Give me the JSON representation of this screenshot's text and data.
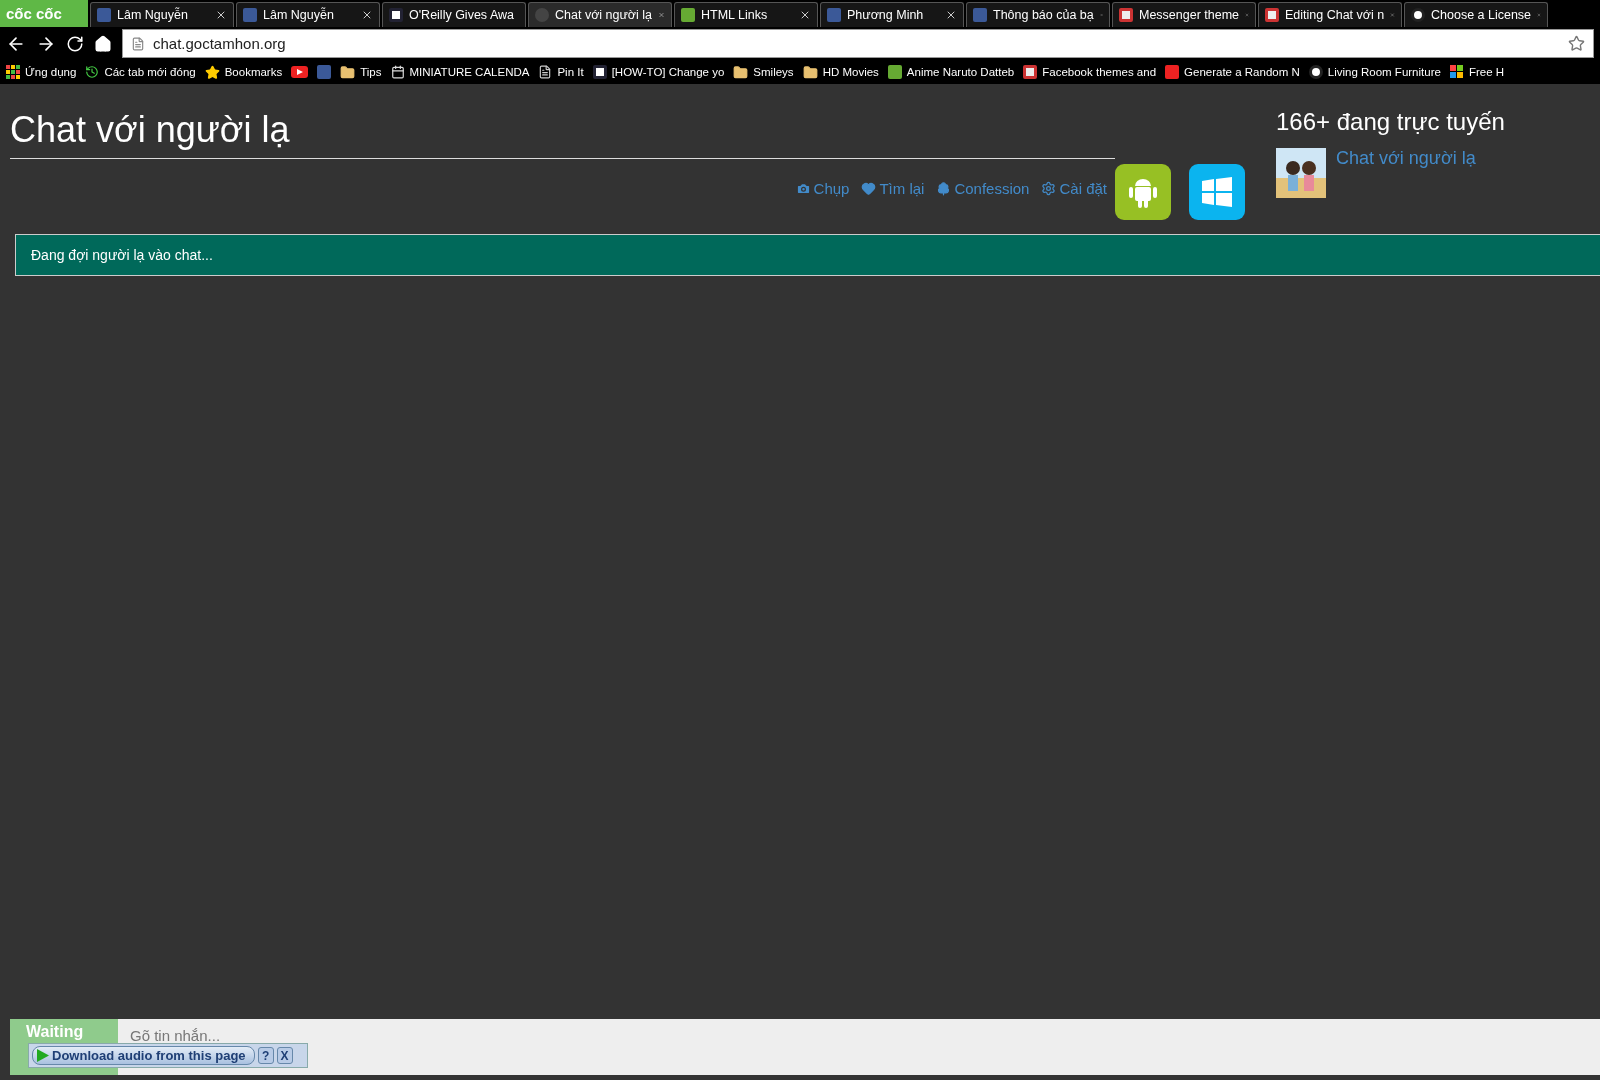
{
  "browser": {
    "logo": "cốc cốc",
    "tabs": [
      {
        "title": "Lâm Nguyễn",
        "kind": "facebook",
        "selected": false
      },
      {
        "title": "Lâm Nguyễn",
        "kind": "facebook",
        "selected": false
      },
      {
        "title": "O'Reilly Gives Awa",
        "kind": "dark",
        "selected": false
      },
      {
        "title": "Chat với người lạ",
        "kind": "bubble",
        "selected": true
      },
      {
        "title": "HTML Links",
        "kind": "green",
        "selected": false
      },
      {
        "title": "Phương Minh",
        "kind": "facebook",
        "selected": false
      },
      {
        "title": "Thông báo của bạ",
        "kind": "facebook",
        "selected": false
      },
      {
        "title": "Messenger theme",
        "kind": "light",
        "selected": false
      },
      {
        "title": "Editing Chat với n",
        "kind": "light",
        "selected": false
      },
      {
        "title": "Choose a License",
        "kind": "circle",
        "selected": false
      }
    ],
    "address": "chat.goctamhon.org",
    "bookmarks": [
      {
        "label": "Ứng dụng",
        "kind": "apps"
      },
      {
        "label": "Các tab mới đóng",
        "kind": "history"
      },
      {
        "label": "Bookmarks",
        "kind": "star"
      },
      {
        "kind": "youtube"
      },
      {
        "kind": "facebook"
      },
      {
        "label": "Tips",
        "kind": "folder"
      },
      {
        "label": "MINIATURE CALENDA",
        "kind": "calendar"
      },
      {
        "label": "Pin It",
        "kind": "page"
      },
      {
        "label": "[HOW-TO] Change yo",
        "kind": "dark"
      },
      {
        "label": "Smileys",
        "kind": "folder"
      },
      {
        "label": "HD Movies",
        "kind": "folder"
      },
      {
        "label": "Anime Naruto Datteb",
        "kind": "green"
      },
      {
        "label": "Facebook themes and",
        "kind": "light"
      },
      {
        "label": "Generate a Random N",
        "kind": "red"
      },
      {
        "label": "Living Room Furniture",
        "kind": "circle"
      },
      {
        "label": "Free H",
        "kind": "windows"
      }
    ]
  },
  "page": {
    "title": "Chat với người lạ",
    "links": [
      {
        "label": "Chụp",
        "kind": "camera"
      },
      {
        "label": "Tìm lại",
        "kind": "heart"
      },
      {
        "label": "Confession",
        "kind": "tree"
      },
      {
        "label": "Cài đặt",
        "kind": "gear"
      }
    ],
    "apps": [
      {
        "kind": "android",
        "color": "#97c024"
      },
      {
        "kind": "windows",
        "color": "#0bb4ef"
      }
    ],
    "online": "166+ đang trực tuyến",
    "feature": {
      "label": "Chat với người lạ"
    },
    "status": "Đang đợi người lạ vào chat...",
    "composer": {
      "status": "Waiting",
      "placeholder": "Gõ tin nhắn..."
    }
  },
  "download_bar": {
    "label": "Download audio from this page",
    "help": "?",
    "close": "X"
  }
}
